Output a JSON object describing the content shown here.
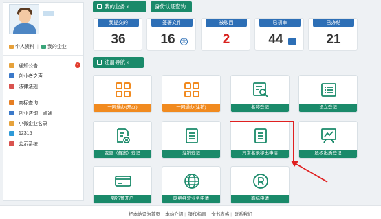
{
  "user": {
    "links": [
      {
        "label": "个人资料",
        "color": "#e7a03a"
      },
      {
        "label": "我的企业",
        "color": "#3aa57a"
      }
    ]
  },
  "menu": [
    {
      "label": "通知公告",
      "icon": "notice-icon",
      "color": "#e6a23c",
      "badge": "4"
    },
    {
      "label": "创业者之声",
      "icon": "voice-icon",
      "color": "#3b79c9"
    },
    {
      "label": "法律法规",
      "icon": "law-icon",
      "color": "#d9534f"
    },
    {
      "label": "商标查询",
      "icon": "trademark-search-icon",
      "color": "#e67e22"
    },
    {
      "label": "创业咨询一点通",
      "icon": "consult-icon",
      "color": "#3b79c9"
    },
    {
      "label": "小微企业名录",
      "icon": "directory-icon",
      "color": "#e6a23c"
    },
    {
      "label": "12315",
      "icon": "complaint-icon",
      "color": "#2e9ad8"
    },
    {
      "label": "公示系统",
      "icon": "publicity-icon",
      "color": "#d9534f"
    }
  ],
  "header": {
    "my_business": "我的业务",
    "my_business_arrow": "»",
    "identity": "身份认证查询",
    "nav": "注册导航",
    "nav_arrow": "»"
  },
  "stats": [
    {
      "label": "我提交的",
      "value": "36"
    },
    {
      "label": "签署文件",
      "value": "16",
      "icon": "签"
    },
    {
      "label": "被驳回",
      "value": "2"
    },
    {
      "label": "已初审",
      "value": "44"
    },
    {
      "label": "已办结",
      "value": "21"
    }
  ],
  "tiles": [
    {
      "label": "一网通办(开办)",
      "icon": "grid-icon",
      "cap": "orange"
    },
    {
      "label": "一网通办(注销)",
      "icon": "grid-icon",
      "cap": "orange"
    },
    {
      "label": "名称登记",
      "icon": "name-search-icon",
      "cap": "green"
    },
    {
      "label": "设立登记",
      "icon": "list-icon",
      "cap": "green"
    },
    {
      "label": "变更（备案）登记",
      "icon": "change-doc-icon",
      "cap": "green"
    },
    {
      "label": "注销登记",
      "icon": "document-icon",
      "cap": "green"
    },
    {
      "label": "异常名录移出申请",
      "icon": "document-icon",
      "cap": "green"
    },
    {
      "label": "股权出质登记",
      "icon": "chart-board-icon",
      "cap": "green"
    },
    {
      "label": "银行预开户",
      "icon": "bank-card-icon",
      "cap": "green"
    },
    {
      "label": "网络经营业务申请",
      "icon": "globe-icon",
      "cap": "green"
    },
    {
      "label": "商标申请",
      "icon": "registered-icon",
      "cap": "green"
    }
  ],
  "footer": {
    "links": [
      "把本站设为首页",
      "本站介绍",
      "操作指南",
      "文书表格",
      "联系我们"
    ]
  }
}
